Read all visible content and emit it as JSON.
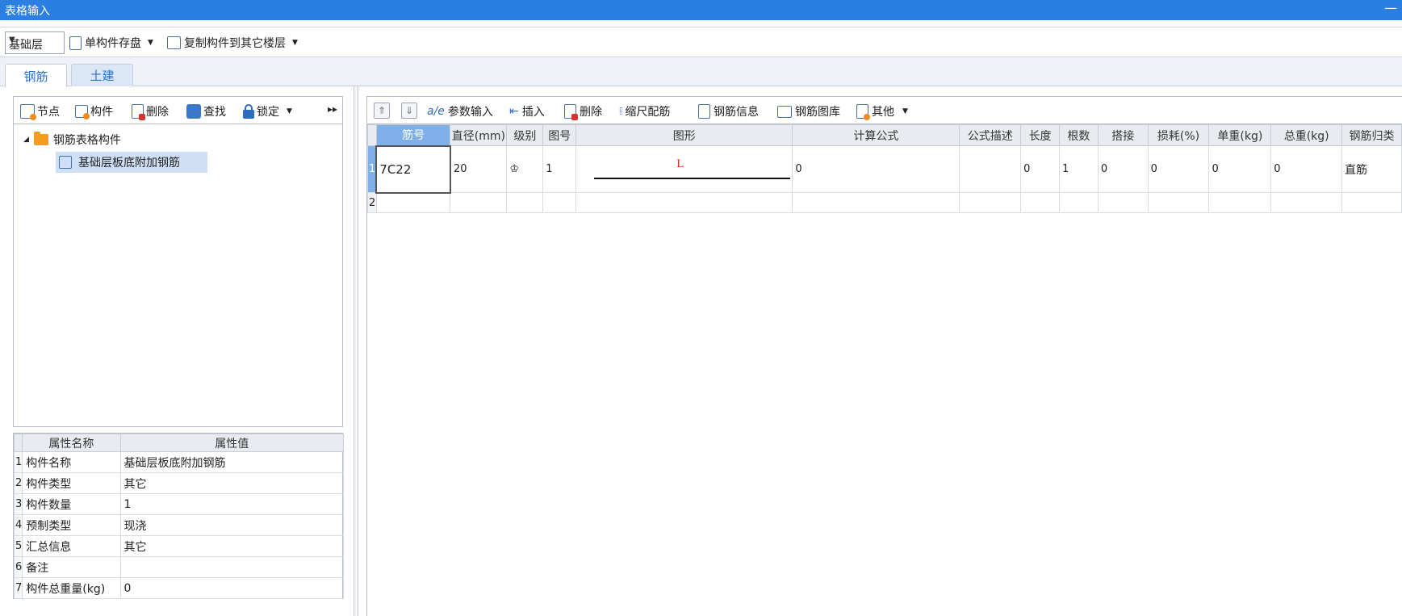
{
  "window": {
    "title": "表格输入",
    "minimize": "—"
  },
  "toolbar": {
    "floor": "基础层",
    "save_component": "单构件存盘",
    "copy_to_floor": "复制构件到其它楼层"
  },
  "tabs": [
    {
      "label": "钢筋",
      "active": true
    },
    {
      "label": "土建",
      "active": false
    }
  ],
  "left_toolbar": {
    "node": "节点",
    "component": "构件",
    "delete": "删除",
    "find": "查找",
    "lock": "锁定",
    "more": "▸▸"
  },
  "tree": {
    "root": "钢筋表格构件",
    "child": "基础层板底附加钢筋"
  },
  "properties": {
    "headers": [
      "属性名称",
      "属性值"
    ],
    "rows": [
      {
        "idx": "1",
        "name": "构件名称",
        "value": "基础层板底附加钢筋"
      },
      {
        "idx": "2",
        "name": "构件类型",
        "value": "其它"
      },
      {
        "idx": "3",
        "name": "构件数量",
        "value": "1"
      },
      {
        "idx": "4",
        "name": "预制类型",
        "value": "现浇"
      },
      {
        "idx": "5",
        "name": "汇总信息",
        "value": "其它"
      },
      {
        "idx": "6",
        "name": "备注",
        "value": ""
      },
      {
        "idx": "7",
        "name": "构件总重量(kg)",
        "value": "0"
      }
    ]
  },
  "right_toolbar": {
    "param_input": "参数输入",
    "insert": "插入",
    "delete": "删除",
    "scale_rebar": "缩尺配筋",
    "rebar_info": "钢筋信息",
    "rebar_library": "钢筋图库",
    "other": "其他"
  },
  "grid": {
    "headers": [
      "筋号",
      "直径(mm)",
      "级别",
      "图号",
      "图形",
      "计算公式",
      "公式描述",
      "长度",
      "根数",
      "搭接",
      "损耗(%)",
      "单重(kg)",
      "总重(kg)",
      "钢筋归类"
    ],
    "rows": [
      {
        "idx": "1",
        "bar_no": "7C22",
        "diameter": "20",
        "grade": "♔",
        "fig_no": "1",
        "shape_label": "L",
        "formula": "0",
        "formula_desc": "",
        "length": "0",
        "count": "1",
        "lap": "0",
        "loss": "0",
        "unit_weight": "0",
        "total_weight": "0",
        "category": "直筋"
      },
      {
        "idx": "2"
      }
    ]
  },
  "colors": {
    "titlebar": "#2b7fe0",
    "selection": "#7fb0ea",
    "tree_selected": "#cfe0f6",
    "shape_label": "#e02020"
  }
}
